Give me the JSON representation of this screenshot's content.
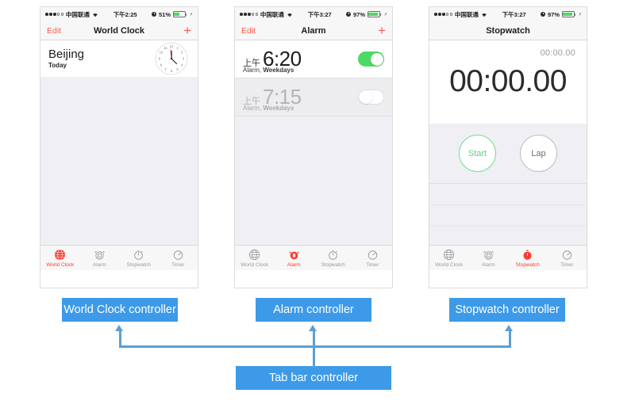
{
  "phones": [
    {
      "id": "world-clock",
      "statusbar": {
        "carrier": "中国联通",
        "time": "下午2:25",
        "battery_pct": "51%",
        "wifi_icon": "wifi-icon",
        "alarm_icon": "alarm-indicator-icon",
        "battery_icon": "battery-icon"
      },
      "nav": {
        "left": "Edit",
        "title": "World Clock",
        "right": "+"
      },
      "content": {
        "city": "Beijing",
        "day": "Today",
        "clock_icon": "analog-clock-face"
      }
    },
    {
      "id": "alarm",
      "statusbar": {
        "carrier": "中国联通",
        "time": "下午3:27",
        "battery_pct": "97%",
        "wifi_icon": "wifi-icon",
        "alarm_icon": "alarm-indicator-icon",
        "battery_icon": "battery-icon"
      },
      "nav": {
        "left": "Edit",
        "title": "Alarm",
        "right": "+"
      },
      "alarms": [
        {
          "ampm": "上午",
          "time": "6:20",
          "label": "Alarm, ",
          "label_bold": "Weekdays",
          "enabled": true
        },
        {
          "ampm": "上午",
          "time": "7:15",
          "label": "Alarm, ",
          "label_bold": "Weekdays",
          "enabled": false
        }
      ]
    },
    {
      "id": "stopwatch",
      "statusbar": {
        "carrier": "中国联通",
        "time": "下午3:27",
        "battery_pct": "97%",
        "wifi_icon": "wifi-icon",
        "alarm_icon": "alarm-indicator-icon",
        "battery_icon": "battery-icon"
      },
      "nav": {
        "left": "",
        "title": "Stopwatch",
        "right": ""
      },
      "content": {
        "lap_time": "00:00.00",
        "main_time": "00:00.00",
        "start_label": "Start",
        "lap_label": "Lap"
      }
    }
  ],
  "tabbar": {
    "items": [
      {
        "label": "World Clock",
        "icon": "globe-icon"
      },
      {
        "label": "Alarm",
        "icon": "alarm-clock-icon"
      },
      {
        "label": "Stopwatch",
        "icon": "stopwatch-icon"
      },
      {
        "label": "Timer",
        "icon": "timer-icon"
      }
    ],
    "active": {
      "world-clock": 0,
      "alarm": 1,
      "stopwatch": 2
    }
  },
  "diagram": {
    "boxes": {
      "world_clock_controller": "World Clock controller",
      "alarm_controller": "Alarm controller",
      "stopwatch_controller": "Stopwatch controller",
      "tab_bar_controller": "Tab bar controller"
    },
    "colors": {
      "box_fill": "#3d9ae8",
      "box_text": "#ffffff",
      "connector": "#5b9fd4"
    }
  },
  "colors": {
    "ios_red": "#ff3b30",
    "ios_green": "#4cd964",
    "screen_bg": "#efeff4",
    "chrome_bg": "#f7f7f7"
  }
}
